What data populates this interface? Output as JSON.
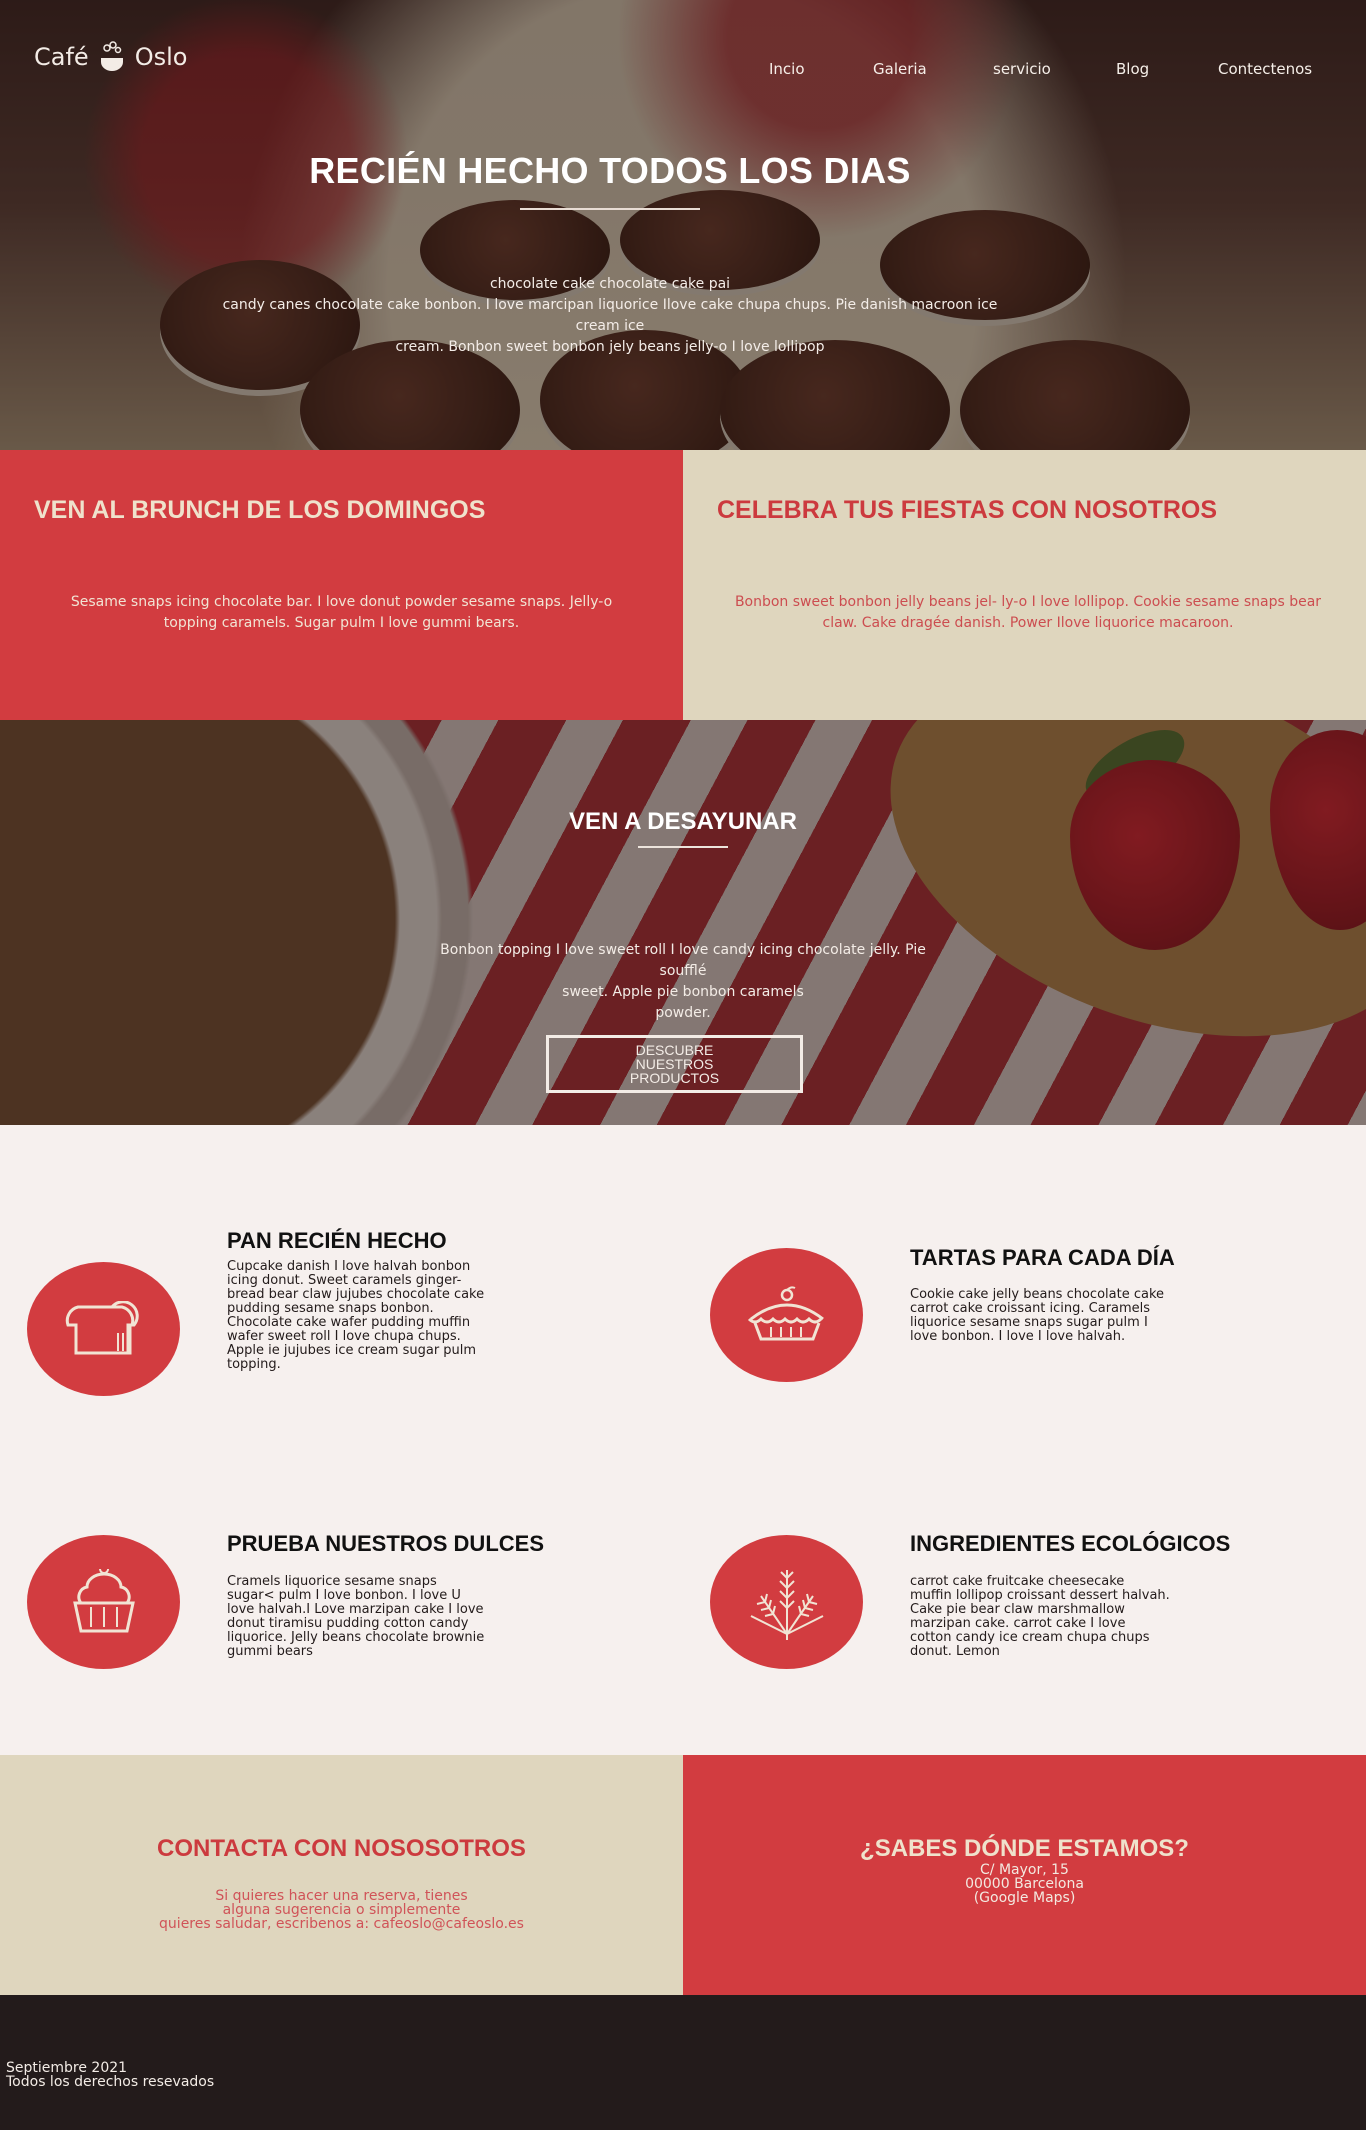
{
  "header": {
    "logo_left": "Café",
    "logo_right": "Oslo",
    "nav": [
      "Incio",
      "Galeria",
      "servicio",
      "Blog",
      "Contectenos"
    ]
  },
  "hero": {
    "title": "RECIÉN HECHO TODOS LOS DIAS",
    "text_lines": [
      "chocolate cake chocolate cake pai",
      "candy canes chocolate cake bonbon. I love marcipan liquorice Ilove cake chupa chups. Pie danish macroon ice cream ice",
      "cream. Bonbon sweet bonbon jely beans jelly-o I love lollipop"
    ]
  },
  "promo": {
    "brunch_title": "VEN AL BRUNCH DE LOS DOMINGOS",
    "brunch_text": "Sesame snaps icing chocolate bar. I love donut powder sesame snaps. Jelly-o topping caramels. Sugar pulm I love gummi bears.",
    "party_title": "CELEBRA TUS FIESTAS CON NOSOTROS",
    "party_text": "Bonbon sweet bonbon jelly beans jel- ly-o I love lollipop. Cookie sesame snaps bear claw. Cake dragée danish. Power Ilove liquorice macaroon."
  },
  "breakfast": {
    "title": "VEN A DESAYUNAR",
    "text_lines": [
      "Bonbon topping I love sweet roll I love candy icing chocolate jelly. Pie soufflé",
      "sweet. Apple pie bonbon caramels",
      "powder."
    ],
    "button": "DESCUBRE NUESTROS PRODUCTOS"
  },
  "features": [
    {
      "icon": "bread-icon",
      "title": "PAN RECIÉN HECHO",
      "text": "Cupcake danish I love halvah bonbon icing donut. Sweet caramels ginger-bread bear claw jujubes chocolate cake pudding sesame snaps bonbon. Chocolate cake wafer pudding muffin wafer sweet roll I love chupa chups. Apple ie jujubes ice cream sugar pulm topping."
    },
    {
      "icon": "pie-icon",
      "title": "TARTAS PARA CADA DÍA",
      "text": "Cookie cake jelly beans chocolate cake carrot cake croissant icing. Caramels liquorice sesame snaps sugar pulm I love bonbon. I love I love halvah."
    },
    {
      "icon": "cupcake-icon",
      "title": "PRUEBA NUESTROS DULCES",
      "text": "Cramels liquorice sesame snaps sugar< pulm I love bonbon. I love U love halvah.I Love marzipan cake I love donut tiramisu pudding cotton candy liquorice. Jelly beans chocolate brownie gummi bears"
    },
    {
      "icon": "wheat-icon",
      "title": "INGREDIENTES ECOLÓGICOS",
      "text": "carrot cake fruitcake cheesecake muffin lollipop croissant dessert halvah. Cake pie bear claw marshmallow marzipan cake. carrot cake I love cotton candy ice cream chupa chups donut. Lemon"
    }
  ],
  "contact": {
    "title": "CONTACTA CON NOSOSOTROS",
    "lines": [
      "Si quieres hacer una reserva, tienes",
      "alguna sugerencia o simplemente",
      "quieres saludar, escribenos a: cafeoslo@cafeoslo.es"
    ]
  },
  "location": {
    "title": "¿SABES DÓNDE ESTAMOS?",
    "lines": [
      "C/ Mayor, 15",
      "00000 Barcelona",
      "(Google Maps)"
    ]
  },
  "footer": {
    "lines": [
      "Septiembre 2021",
      "Todos los derechos resevados"
    ]
  },
  "colors": {
    "red": "#d23c40",
    "beige": "#dfd6be",
    "dark": "#231b1b",
    "light": "#f6f0ee"
  }
}
